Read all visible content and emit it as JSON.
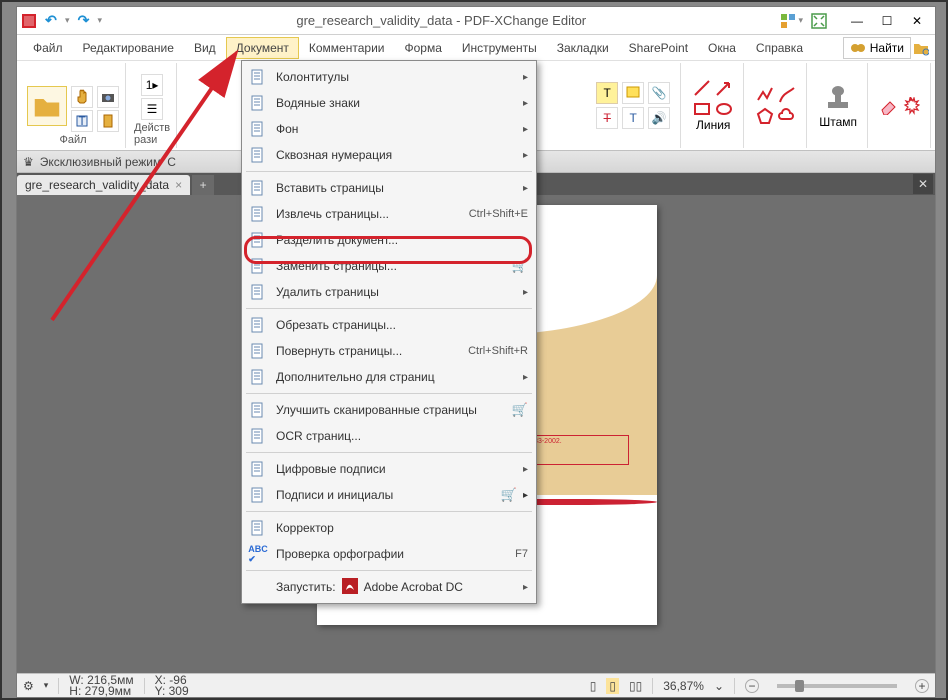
{
  "window_title": "gre_research_validity_data - PDF-XChange Editor",
  "title_icon": "app-icon",
  "qat": {
    "undo": "↶",
    "redo": "↷"
  },
  "sys": {
    "min": "—",
    "max": "☐",
    "close": "✕"
  },
  "menubar": {
    "items": [
      "Файл",
      "Редактирование",
      "Вид",
      "Документ",
      "Комментарии",
      "Форма",
      "Инструменты",
      "Закладки",
      "SharePoint",
      "Окна",
      "Справка"
    ],
    "find_label": "Найти"
  },
  "ribbon": {
    "file": "Файл",
    "actions": "Действ\nрази",
    "line": "Линия",
    "stamp": "Штамп",
    "soglasov": "С"
  },
  "modebar": {
    "exclusive": "Эксклюзивный режим"
  },
  "doctab": {
    "name": "gre_research_validity_data",
    "close": "×",
    "plus": "+"
  },
  "page": {
    "tel": "9) 683-2002."
  },
  "status": {
    "w": "W: 216,5мм",
    "h": "H: 279,9мм",
    "x": "X: -96",
    "y": "Y: 309",
    "zoom": "36,87%",
    "zoom_drop": "⌄",
    "minus": "−",
    "plus": "+"
  },
  "dropdown": {
    "items": [
      {
        "label": "Колонтитулы",
        "sub": true
      },
      {
        "label": "Водяные знаки",
        "sub": true
      },
      {
        "label": "Фон",
        "sub": true
      },
      {
        "label": "Сквозная нумерация",
        "sub": true
      },
      {
        "sep": true
      },
      {
        "label": "Вставить страницы",
        "sub": true
      },
      {
        "label": "Извлечь страницы...",
        "shortcut": "Ctrl+Shift+E",
        "hl": true
      },
      {
        "label": "Разделить документ..."
      },
      {
        "label": "Заменить страницы...",
        "cart": true
      },
      {
        "label": "Удалить страницы",
        "sub": true
      },
      {
        "sep": true
      },
      {
        "label": "Обрезать страницы...",
        "shortcut": ""
      },
      {
        "label": "Повернуть страницы...",
        "shortcut": "Ctrl+Shift+R"
      },
      {
        "label": "Дополнительно для страниц",
        "sub": true
      },
      {
        "sep": true
      },
      {
        "label": "Улучшить сканированные страницы",
        "cart": true
      },
      {
        "label": "OCR страниц..."
      },
      {
        "sep": true
      },
      {
        "label": "Цифровые подписи",
        "sub": true
      },
      {
        "label": "Подписи и инициалы",
        "cart": true,
        "sub": true
      },
      {
        "sep": true
      },
      {
        "label": "Корректор"
      },
      {
        "label": "Проверка орфографии",
        "shortcut": "F7",
        "abc": true
      },
      {
        "sep": true
      },
      {
        "label": "Запустить:",
        "launch": "Adobe Acrobat DC",
        "sub": true
      }
    ]
  }
}
